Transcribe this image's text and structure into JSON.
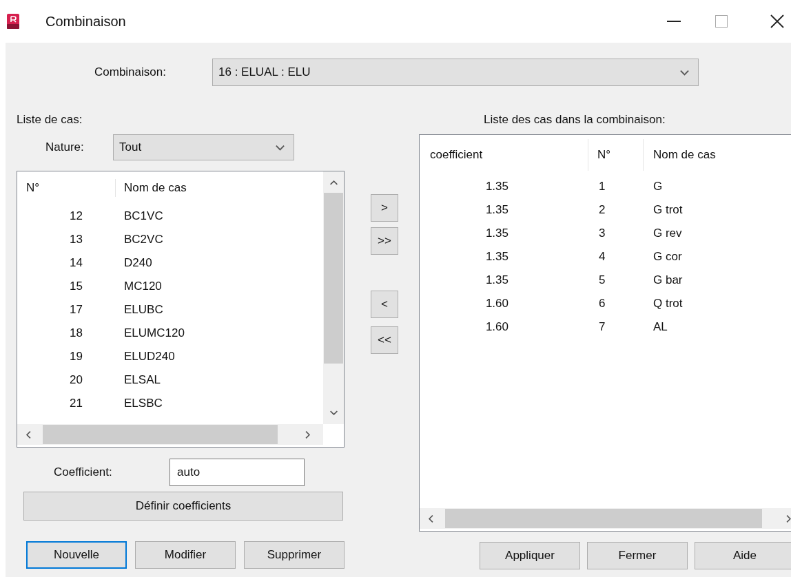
{
  "window": {
    "title": "Combinaison"
  },
  "combinaison": {
    "label": "Combinaison:",
    "value": "16 : ELUAL : ELU"
  },
  "case_list": {
    "heading": "Liste de cas:",
    "nature": {
      "label": "Nature:",
      "value": "Tout"
    },
    "columns": [
      "N°",
      "Nom de cas"
    ],
    "rows": [
      [
        "12",
        "BC1VC"
      ],
      [
        "13",
        "BC2VC"
      ],
      [
        "14",
        "D240"
      ],
      [
        "15",
        "MC120"
      ],
      [
        "17",
        "ELUBC"
      ],
      [
        "18",
        "ELUMC120"
      ],
      [
        "19",
        "ELUD240"
      ],
      [
        "20",
        "ELSAL"
      ],
      [
        "21",
        "ELSBC"
      ]
    ],
    "coefficient": {
      "label": "Coefficient:",
      "value": "auto"
    },
    "define_button": "Définir coefficients"
  },
  "transfer_buttons": [
    ">",
    ">>",
    "<",
    "<<"
  ],
  "left_buttons": [
    {
      "label": "Nouvelle",
      "focused": true
    },
    {
      "label": "Modifier",
      "focused": false
    },
    {
      "label": "Supprimer",
      "focused": false
    }
  ],
  "combination_list": {
    "heading": "Liste des cas dans la combinaison:",
    "columns": [
      "coefficient",
      "N°",
      "Nom de cas"
    ],
    "rows": [
      [
        "1.35",
        "1",
        "G"
      ],
      [
        "1.35",
        "2",
        "G trot"
      ],
      [
        "1.35",
        "3",
        "G rev"
      ],
      [
        "1.35",
        "4",
        "G cor"
      ],
      [
        "1.35",
        "5",
        "G bar"
      ],
      [
        "1.60",
        "6",
        "Q trot"
      ],
      [
        "1.60",
        "7",
        "AL"
      ]
    ]
  },
  "right_buttons": [
    {
      "label": "Appliquer",
      "focused": false
    },
    {
      "label": "Fermer",
      "focused": false
    },
    {
      "label": "Aide",
      "focused": false
    }
  ]
}
